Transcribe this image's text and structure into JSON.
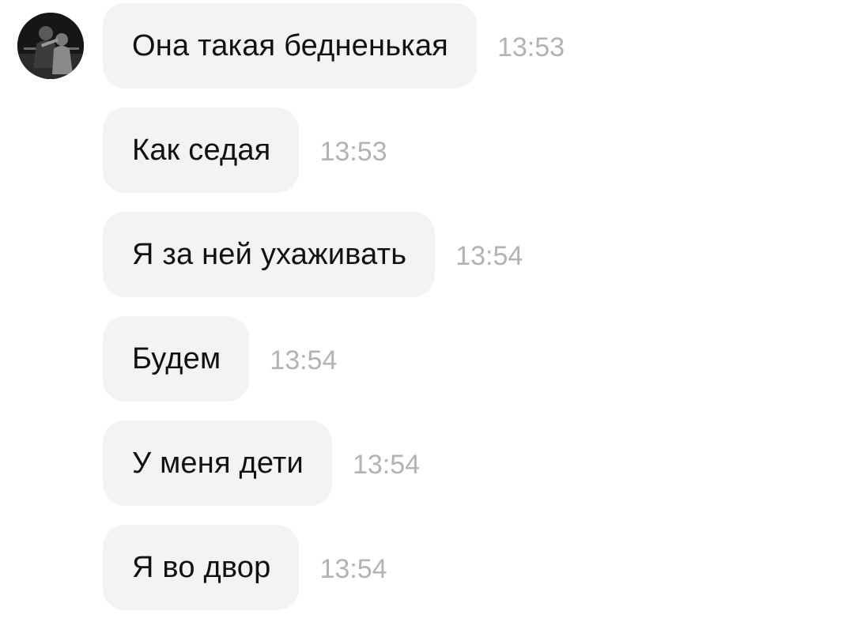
{
  "chat": {
    "avatar_icon": "user-photo-avatar",
    "messages": [
      {
        "text": "Она такая бедненькая",
        "time": "13:53"
      },
      {
        "text": "Как седая",
        "time": "13:53"
      },
      {
        "text": "Я за ней ухаживать",
        "time": "13:54"
      },
      {
        "text": "Будем",
        "time": "13:54"
      },
      {
        "text": "У меня дети",
        "time": "13:54"
      },
      {
        "text": "Я во двор",
        "time": "13:54"
      }
    ]
  },
  "colors": {
    "bubble_background": "#f3f3f3",
    "message_text": "#111111",
    "timestamp_text": "#b3b3b3",
    "page_background": "#ffffff"
  }
}
